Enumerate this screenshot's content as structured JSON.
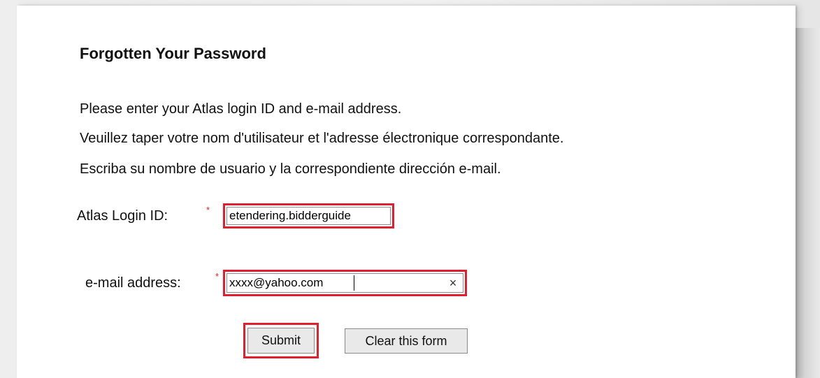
{
  "page": {
    "title": "Forgotten Your Password"
  },
  "instructions": [
    "Please enter your Atlas login ID and e-mail address.",
    "Veuillez taper votre nom d'utilisateur et l'adresse électronique correspondante.",
    "Escriba su nombre de usuario y la correspondiente dirección e-mail."
  ],
  "form": {
    "login_label": "Atlas Login ID:",
    "login_value": "etendering.bidderguide",
    "email_label": "e-mail address:",
    "email_value": "xxxx@yahoo.com",
    "required_mark": "*",
    "clear_icon": "×",
    "submit_label": "Submit",
    "clear_label": "Clear this form"
  },
  "colors": {
    "highlight": "#e0202e",
    "required": "#dd2222"
  },
  "icons": {
    "clear_field": "close-icon"
  }
}
